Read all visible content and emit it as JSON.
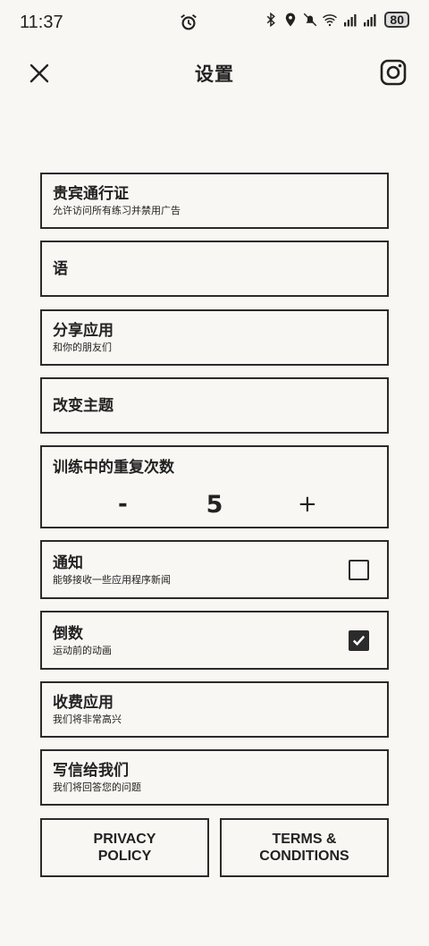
{
  "status_bar": {
    "time": "11:37",
    "battery": "80",
    "icons": [
      "alarm-icon",
      "bluetooth-icon",
      "location-icon",
      "mute-icon",
      "wifi-icon",
      "signal-4g-icon",
      "signal-4g-icon",
      "battery-icon"
    ]
  },
  "header": {
    "title": "设置",
    "close_icon": "close-icon",
    "instagram_icon": "instagram-icon"
  },
  "settings": {
    "vip": {
      "title": "贵宾通行证",
      "subtitle": "允许访问所有练习并禁用广告"
    },
    "language": {
      "title": "语"
    },
    "share": {
      "title": "分享应用",
      "subtitle": "和你的朋友们"
    },
    "theme": {
      "title": "改变主题"
    },
    "reps": {
      "title": "训练中的重复次数",
      "minus": "-",
      "value": "5",
      "plus": "+"
    },
    "notifications": {
      "title": "通知",
      "subtitle": "能够接收一些应用程序新闻",
      "checked": false
    },
    "countdown": {
      "title": "倒数",
      "subtitle": "运动前的动画",
      "checked": true
    },
    "paid": {
      "title": "收费应用",
      "subtitle": "我们将非常高兴"
    },
    "write": {
      "title": "写信给我们",
      "subtitle": "我们将回答您的问题"
    }
  },
  "footer": {
    "privacy_line1": "PRIVACY",
    "privacy_line2": "POLICY",
    "terms_line1": "TERMS &",
    "terms_line2": "CONDITIONS"
  },
  "colors": {
    "background": "#f8f7f3",
    "border": "#2b2b2b",
    "text": "#222222"
  }
}
